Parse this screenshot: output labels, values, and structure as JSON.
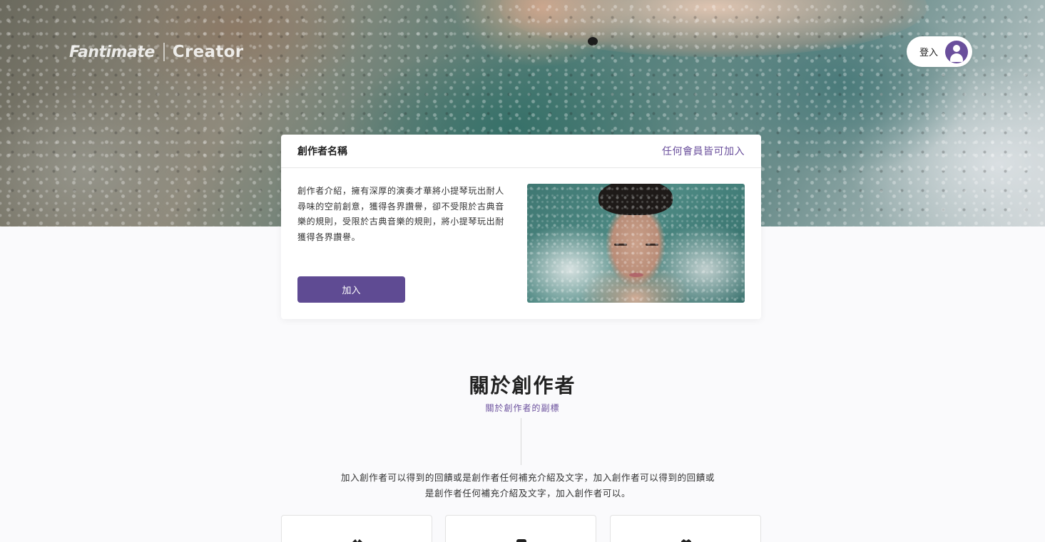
{
  "header": {
    "logo_brand": "Fantimate",
    "logo_product": "Creator",
    "login_label": "登入"
  },
  "creator_card": {
    "name": "創作者名稱",
    "access": "任何會員皆可加入",
    "description": "創作者介紹，擁有深厚的演奏才華將小提琴玩出耐人尋味的空前創意，獲得各界讚譽，卻不受限於古典音樂的規則，受限於古典音樂的規則，將小提琴玩出耐獲得各界讚譽。",
    "join_label": "加入"
  },
  "about": {
    "title": "關於創作者",
    "subtitle": "關於創作者的副標",
    "text_line1": "加入創作者可以得到的回饋或是創作者任何補充介紹及文字，加入創作者可以得到的回饋或",
    "text_line2": "是創作者任何補充介紹及文字，加入創作者可以。"
  },
  "benefits": [
    {
      "icon": "crown-icon"
    },
    {
      "icon": "badge-icon"
    },
    {
      "icon": "heart-icon"
    }
  ],
  "colors": {
    "accent": "#6a4f9c",
    "button": "#5f4b93",
    "background": "#fafafc"
  }
}
